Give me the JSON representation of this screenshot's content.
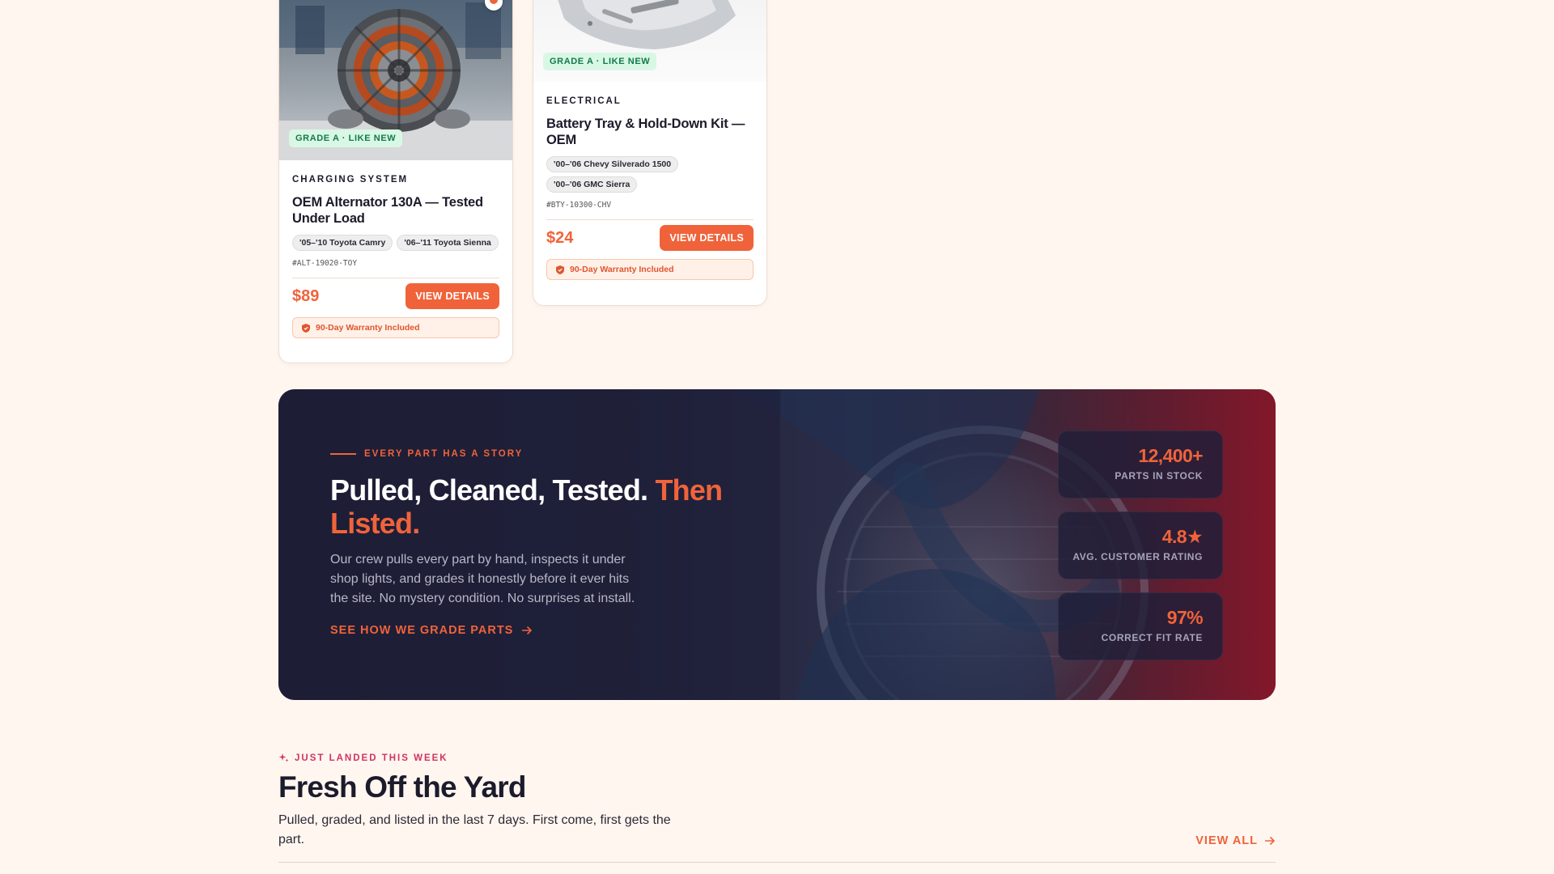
{
  "products": [
    {
      "grade": "GRADE A · LIKE NEW",
      "category": "CHARGING SYSTEM",
      "title": "OEM Alternator 130A — Tested Under Load",
      "fitment": [
        "'05–'10 Toyota Camry",
        "'06–'11 Toyota Sienna"
      ],
      "sku": "#ALT-19020-TOY",
      "price": "$89",
      "button": "VIEW DETAILS",
      "warranty": "90-Day Warranty Included"
    },
    {
      "grade": "GRADE A · LIKE NEW",
      "category": "ELECTRICAL",
      "title": "Battery Tray & Hold-Down Kit — OEM",
      "fitment": [
        "'00–'06 Chevy Silverado 1500",
        "'00–'06 GMC Sierra"
      ],
      "sku": "#BTY-10300-CHV",
      "price": "$24",
      "button": "VIEW DETAILS",
      "warranty": "90-Day Warranty Included"
    }
  ],
  "story": {
    "eyebrow": "EVERY PART HAS A STORY",
    "heading_main": "Pulled, Cleaned, Tested.",
    "heading_accent": "Then Listed.",
    "body": "Our crew pulls every part by hand, inspects it under shop lights, and grades it honestly before it ever hits the site. No mystery condition. No surprises at install.",
    "link": "SEE HOW WE GRADE PARTS",
    "stats": [
      {
        "value": "12,400+",
        "label": "PARTS IN STOCK"
      },
      {
        "value": "4.8★",
        "label": "AVG. CUSTOMER RATING"
      },
      {
        "value": "97%",
        "label": "CORRECT FIT RATE"
      }
    ]
  },
  "fresh": {
    "eyebrow": "JUST LANDED THIS WEEK",
    "title": "Fresh Off the Yard",
    "subtitle": "Pulled, graded, and listed in the last 7 days. First come, first gets the part.",
    "view_all": "VIEW ALL"
  },
  "colors": {
    "accent": "#f0633a",
    "background": "#fff6f0",
    "banner_dark": "#1d1e36",
    "grade_badge_bg": "#d9f7e5",
    "eyebrow_pink": "#d0335e"
  },
  "icons": {
    "warranty": "shield-icon",
    "link_arrow": "arrow-right-icon",
    "sparkle": "sparkle-icon"
  }
}
